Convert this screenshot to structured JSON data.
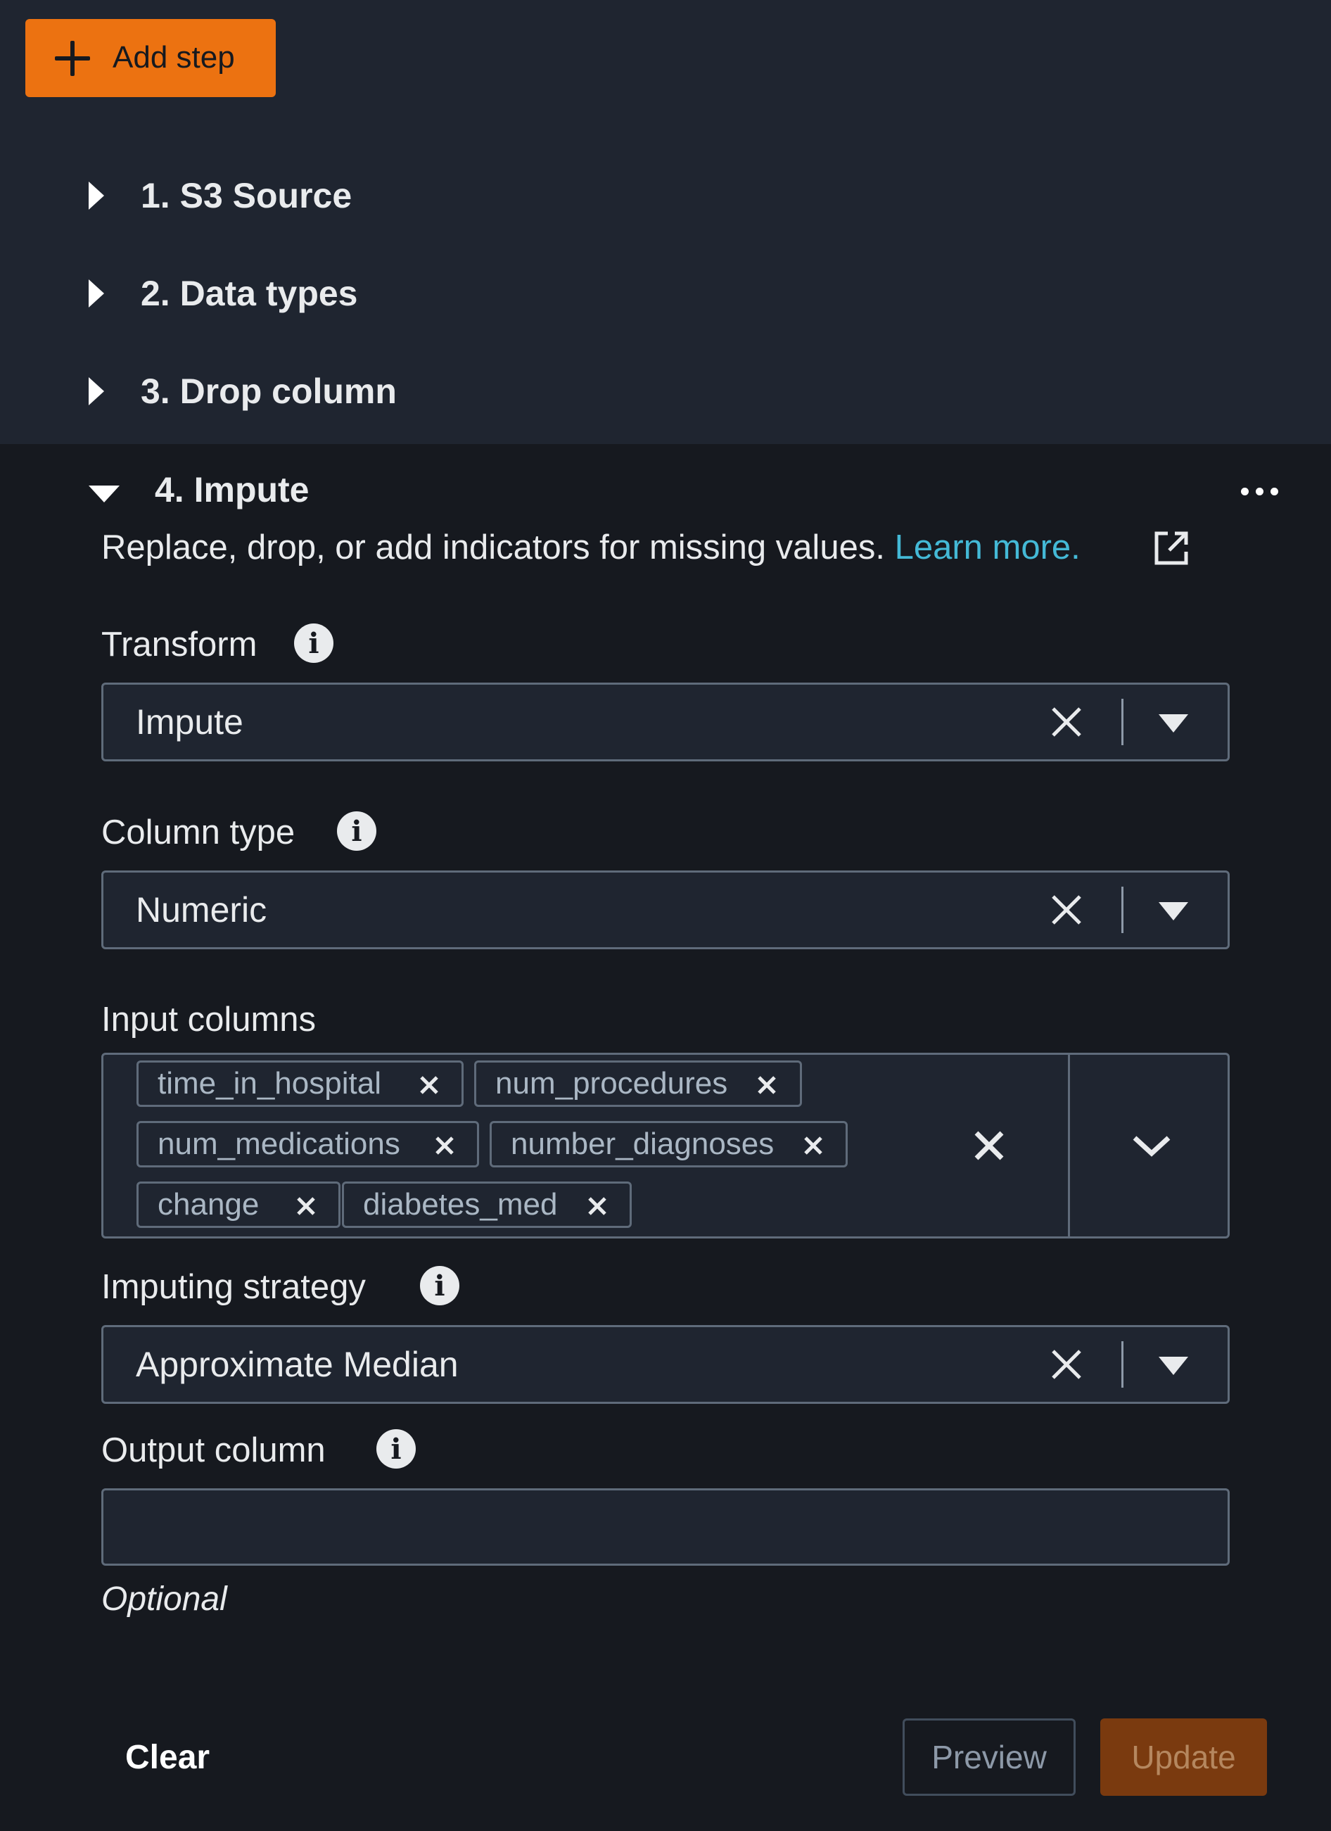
{
  "toolbar": {
    "add_step_label": "Add step"
  },
  "steps": [
    {
      "label": "1. S3 Source"
    },
    {
      "label": "2. Data types"
    },
    {
      "label": "3. Drop column"
    }
  ],
  "active_step": {
    "title": "4. Impute",
    "description": "Replace, drop, or add indicators for missing values.",
    "learn_more": "Learn more."
  },
  "fields": {
    "transform": {
      "label": "Transform",
      "value": "Impute"
    },
    "column_type": {
      "label": "Column type",
      "value": "Numeric"
    },
    "input_columns": {
      "label": "Input columns",
      "tokens": [
        "time_in_hospital",
        "num_procedures",
        "num_medications",
        "number_diagnoses",
        "change",
        "diabetes_med"
      ]
    },
    "imputing_strategy": {
      "label": "Imputing strategy",
      "value": "Approximate Median"
    },
    "output_column": {
      "label": "Output column",
      "value": "",
      "hint": "Optional"
    }
  },
  "footer": {
    "clear": "Clear",
    "preview": "Preview",
    "update": "Update"
  },
  "colors": {
    "accent": "#ec7211",
    "link": "#44b9d6",
    "background": "#16191f",
    "panel": "#1f2530"
  },
  "icons": [
    "plus-icon",
    "caret-right-icon",
    "caret-down-icon",
    "more-icon",
    "external-link-icon",
    "info-icon",
    "close-icon",
    "dropdown-triangle-icon",
    "chevron-down-icon"
  ]
}
